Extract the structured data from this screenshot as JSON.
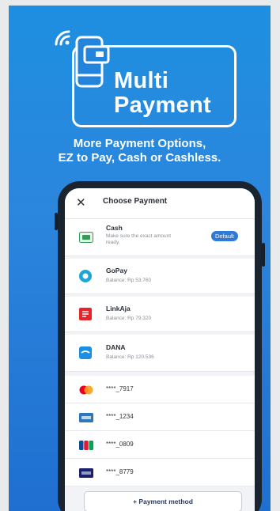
{
  "hero": {
    "title_line1": "Multi",
    "title_line2": "Payment",
    "tagline_line1": "More Payment Options,",
    "tagline_line2": "EZ to Pay, Cash or Cashless."
  },
  "screen": {
    "close_icon": "close-icon",
    "title": "Choose Payment",
    "cash": {
      "name": "Cash",
      "sub_line1": "Make sure the exact amount",
      "sub_line2": "ready.",
      "badge": "Default"
    },
    "wallets": [
      {
        "name": "GoPay",
        "balance": "Balance: Rp 53.760",
        "icon": "gopay-icon",
        "color": "#1aa7d8"
      },
      {
        "name": "LinkAja",
        "balance": "Balance: Rp 79.320",
        "icon": "linkaja-icon",
        "color": "#e8242a"
      },
      {
        "name": "DANA",
        "balance": "Balance: Rp 120.536",
        "icon": "dana-icon",
        "color": "#1b8de3"
      }
    ],
    "cards": [
      {
        "number": "****_7917",
        "icon": "mastercard-icon"
      },
      {
        "number": "****_1234",
        "icon": "amex-icon"
      },
      {
        "number": "****_0809",
        "icon": "jcb-icon"
      },
      {
        "number": "****_8779",
        "icon": "visa-icon"
      }
    ],
    "add_button": "+ Payment method"
  },
  "colors": {
    "background": "#1e8fe0",
    "accent": "#2f7ad6",
    "device": "#1a2430"
  }
}
